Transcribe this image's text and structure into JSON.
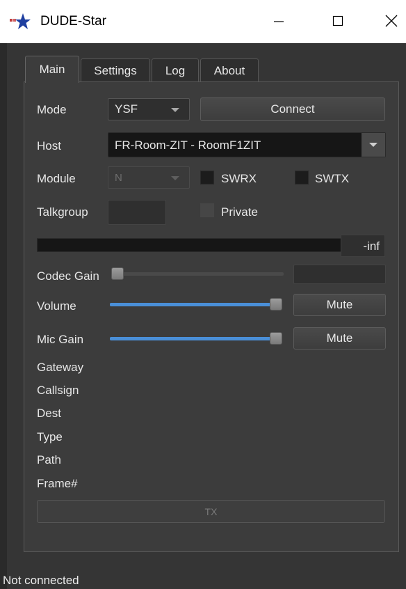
{
  "window": {
    "title": "DUDE-Star",
    "controls": {
      "minimize": "—",
      "maximize": "☐",
      "close": "✕"
    },
    "icon": "star-logo-icon"
  },
  "tabs": [
    {
      "label": "Main",
      "active": true
    },
    {
      "label": "Settings",
      "active": false
    },
    {
      "label": "Log",
      "active": false
    },
    {
      "label": "About",
      "active": false
    }
  ],
  "main": {
    "mode": {
      "label": "Mode",
      "value": "YSF"
    },
    "connect_label": "Connect",
    "host": {
      "label": "Host",
      "value": "FR-Room-ZIT - RoomF1ZIT"
    },
    "module": {
      "label": "Module",
      "value": "N"
    },
    "swrx_label": "SWRX",
    "swtx_label": "SWTX",
    "talkgroup": {
      "label": "Talkgroup",
      "value": ""
    },
    "private_label": "Private",
    "level_readout": "-inf",
    "codec_gain": {
      "label": "Codec Gain",
      "level": 0.0,
      "value": ""
    },
    "volume": {
      "label": "Volume",
      "level": 1.0,
      "mute_label": "Mute"
    },
    "mic_gain": {
      "label": "Mic Gain",
      "level": 1.0,
      "mute_label": "Mute"
    },
    "info_labels": [
      "Gateway",
      "Callsign",
      "Dest",
      "Type",
      "Path",
      "Frame#"
    ],
    "tx_label": "TX"
  },
  "status": {
    "text": "Not connected"
  },
  "colors": {
    "background": "#353535",
    "panel": "#3c3c3c",
    "slider_fill": "#4a8fd8",
    "text": "#e6e6e6"
  }
}
